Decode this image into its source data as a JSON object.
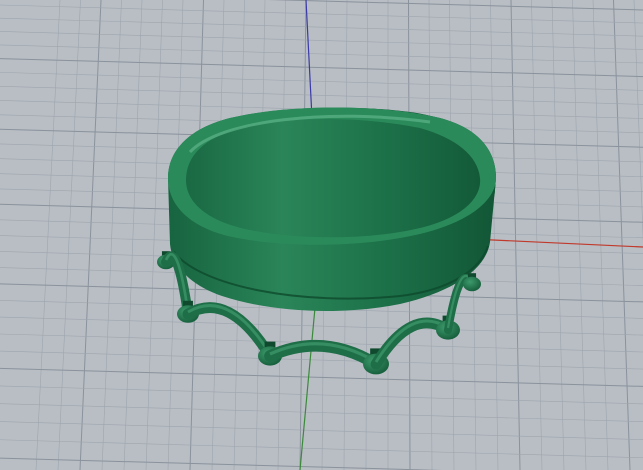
{
  "viewport": {
    "view_type": "perspective",
    "grid_visible": true,
    "background_color": "#b9bec4",
    "grid_minor_color": "#9ea5ae",
    "grid_major_color": "#8a929c",
    "axes": {
      "x_axis_color": "#c0392b",
      "y_axis_color": "#3a8a3a",
      "z_axis_color": "#3a3aa8"
    }
  },
  "model": {
    "object": "crown-ring",
    "material_color": "#1e6e48",
    "highlight_color": "#3f9a6c",
    "shadow_color": "#0f4a2e",
    "prong_count": 10
  }
}
